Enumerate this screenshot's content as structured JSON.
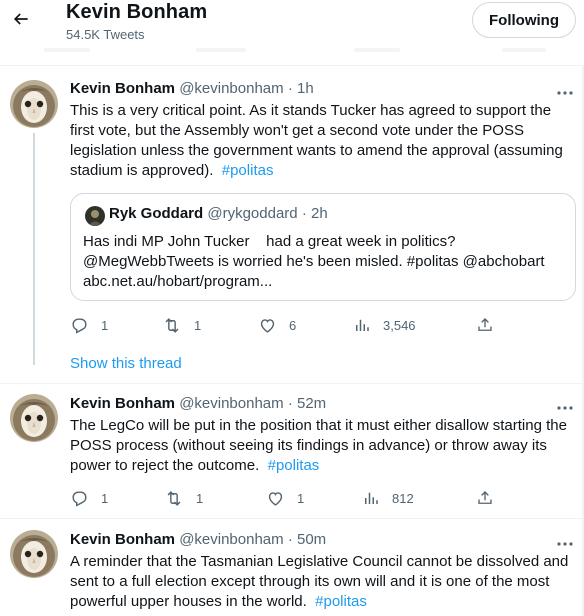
{
  "header": {
    "name": "Kevin Bonham",
    "tweet_count": "54.5K Tweets",
    "follow_label": "Following"
  },
  "tweets": [
    {
      "name": "Kevin Bonham",
      "handle": "@kevinbonham",
      "time": "· 1h",
      "text": "This is a very critical point.  As it stands Tucker has agreed to support the first vote, but the Assembly won't get a second vote under the POSS legislation unless the government wants to amend the approval (assuming stadium is approved).",
      "hashtag": "#politas",
      "quote": {
        "name": "Ryk Goddard",
        "handle": "@rykgoddard",
        "time": "· 2h",
        "line1": "Has indi MP John Tucker    had a great week in politics?",
        "line2": "@MegWebbTweets is worried he's been misled. #politas @abchobart",
        "line3": "abc.net.au/hobart/program..."
      },
      "replies": "1",
      "retweets": "1",
      "likes": "6",
      "views": "3,546",
      "show_thread": "Show this thread"
    },
    {
      "name": "Kevin Bonham",
      "handle": "@kevinbonham",
      "time": "· 52m",
      "text": "The LegCo will be put in the position that it must either disallow starting the POSS process (without seeing its findings in advance) or throw away its power to reject the outcome.",
      "hashtag": "#politas",
      "replies": "1",
      "retweets": "1",
      "likes": "1",
      "views": "812"
    },
    {
      "name": "Kevin Bonham",
      "handle": "@kevinbonham",
      "time": "· 50m",
      "text": "A reminder that the Tasmanian Legislative Council cannot be dissolved and sent to a full election except through its own will and it is one of the most powerful upper houses in the world.",
      "hashtag": "#politas"
    }
  ],
  "icons": {
    "back": "arrow-left-icon",
    "more": "more-dots-icon",
    "reply": "reply-bubble-icon",
    "retweet": "retweet-icon",
    "like": "heart-icon",
    "views": "bar-chart-icon",
    "share": "share-upload-icon"
  },
  "colors": {
    "accent": "#1d9bf0",
    "text": "#0f1419",
    "muted": "#536471",
    "border": "#cfd9de"
  }
}
